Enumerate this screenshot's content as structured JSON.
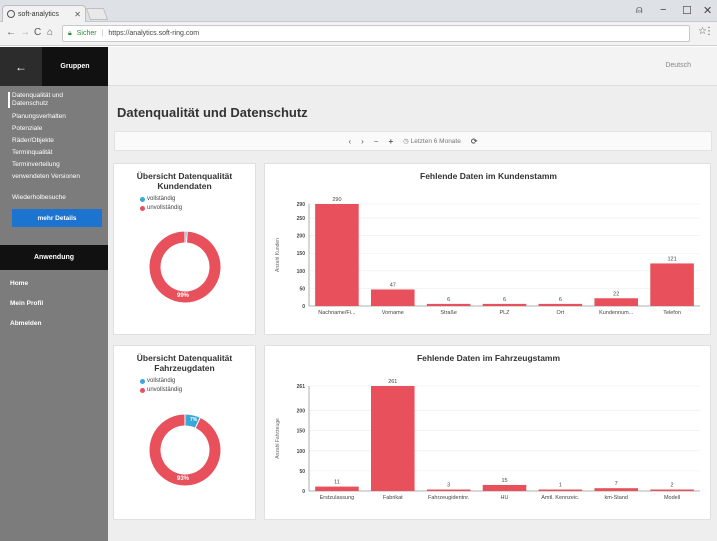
{
  "browser": {
    "tab_title": "soft-analytics",
    "secure_label": "Sicher",
    "url": "https://analytics.soft-ring.com"
  },
  "sidebar": {
    "header_label": "Gruppen",
    "items": [
      {
        "label": "Datenqualität und Datenschutz"
      },
      {
        "label": "Planungsverhalten"
      },
      {
        "label": "Potenziale"
      },
      {
        "label": "Räder/Objekte"
      },
      {
        "label": "Terminqualität"
      },
      {
        "label": "Terminverteilung"
      },
      {
        "label": "verwendeten Versionen"
      },
      {
        "label": "Wiederholbesuche"
      }
    ],
    "details_button": "mehr Details",
    "section_label": "Anwendung",
    "links": [
      {
        "label": "Home"
      },
      {
        "label": "Mein Profil"
      },
      {
        "label": "Abmelden"
      }
    ]
  },
  "header": {
    "language": "Deutsch"
  },
  "main": {
    "title": "Datenqualität und Datenschutz",
    "toolbar": {
      "prev": "‹",
      "next": "›",
      "zoom_out": "−",
      "zoom_in": "+",
      "period": "Letzten 6 Monate",
      "refresh": "⟳"
    }
  },
  "colors": {
    "complete": "#3aa7d9",
    "incomplete": "#e8505b",
    "bar": "#e8505b"
  },
  "cards": {
    "kunden_overview": {
      "title": "Übersicht Datenqualität Kundendaten",
      "legend_complete": "vollständig",
      "legend_incomplete": "unvollständig"
    },
    "fahrzeug_overview": {
      "title": "Übersicht Datenqualität Fahrzeugdaten",
      "legend_complete": "vollständig",
      "legend_incomplete": "unvollständig"
    }
  },
  "chart_data": [
    {
      "type": "pie",
      "slices": [
        {
          "label": "vollständig",
          "value": 1
        },
        {
          "label": "unvollständig",
          "value": 99
        }
      ],
      "data_labels": [
        "99%"
      ]
    },
    {
      "type": "bar",
      "title": "Fehlende Daten im Kundenstamm",
      "ylabel": "Anzahl Kunden",
      "categories": [
        "Nachname/Fi...",
        "Vorname",
        "Straße",
        "PLZ",
        "Ort",
        "Kundennum...",
        "Telefon"
      ],
      "values": [
        290,
        47,
        6,
        6,
        6,
        22,
        121
      ],
      "data_labels": [
        "290",
        "47",
        "6",
        "6",
        "6",
        "22",
        "121"
      ],
      "ylim": [
        0,
        290
      ],
      "yticks": [
        "0",
        "50",
        "100",
        "150",
        "200",
        "250",
        "290"
      ]
    },
    {
      "type": "pie",
      "slices": [
        {
          "label": "vollständig",
          "value": 7
        },
        {
          "label": "unvollständig",
          "value": 93
        }
      ],
      "data_labels": [
        "93%",
        "7%"
      ]
    },
    {
      "type": "bar",
      "title": "Fehlende Daten im Fahrzeugstamm",
      "ylabel": "Anzahl Fahrzeuge",
      "categories": [
        "Erstzulassung",
        "Fabrikat",
        "Fahrzeugidentnr.",
        "HU",
        "Amtl. Kennzeic.",
        "km-Stand",
        "Modell"
      ],
      "values": [
        11,
        261,
        3,
        15,
        1,
        7,
        2
      ],
      "data_labels": [
        "11",
        "261",
        "3",
        "15",
        "1",
        "7",
        "2"
      ],
      "ylim": [
        0,
        261
      ],
      "yticks": [
        "0",
        "50",
        "100",
        "150",
        "200",
        "261"
      ]
    }
  ]
}
